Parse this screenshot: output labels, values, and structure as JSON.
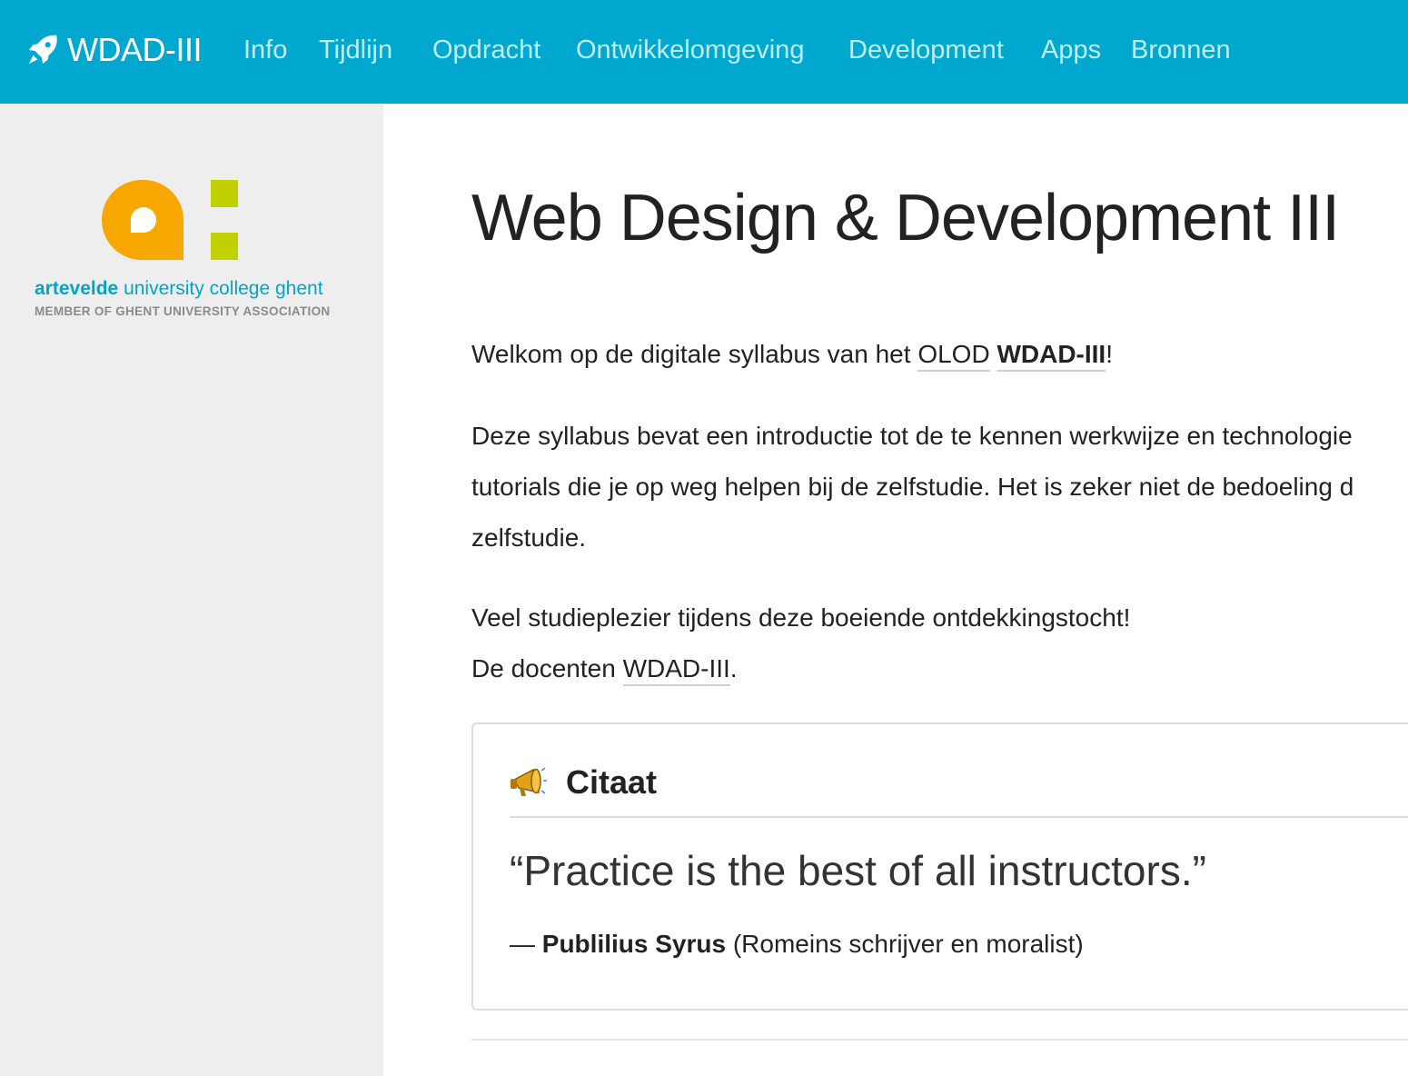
{
  "header": {
    "brand": "WDAD-III",
    "nav": [
      {
        "label": "Info"
      },
      {
        "label": "Tijdlijn"
      },
      {
        "label": "Opdracht"
      },
      {
        "label": "Ontwikkelomgeving"
      },
      {
        "label": "Development"
      },
      {
        "label": "Apps"
      },
      {
        "label": "Bronnen"
      }
    ],
    "colors": {
      "bar": "#00a8d0",
      "nav_text": "#bdeef8"
    }
  },
  "sidebar": {
    "logo": {
      "name_bold": "artevelde",
      "name_rest": " university college ghent",
      "member": "MEMBER OF GHENT UNIVERSITY ASSOCIATION",
      "colors": {
        "orange": "#f6a800",
        "green": "#c1d100",
        "text": "#00a5c8"
      }
    }
  },
  "main": {
    "title": "Web Design & Development III",
    "welcome": {
      "before": "Welkom op de digitale syllabus van het ",
      "olod": "OLOD",
      "space": " ",
      "course": "WDAD-III",
      "after": "!"
    },
    "intro_lines": [
      "Deze syllabus bevat een introductie tot de te kennen werkwijze en technologie",
      "tutorials die je op weg helpen bij de zelfstudie. Het is zeker niet de bedoeling d",
      "zelfstudie."
    ],
    "closing": "Veel studieplezier tijdens deze boeiende ontdekkingstocht!",
    "signature": {
      "before": "De docenten ",
      "course": "WDAD-III",
      "after": "."
    },
    "quote_card": {
      "icon": "megaphone-icon",
      "title": "Citaat",
      "quote": "“Practice is the best of all instructors.”",
      "dash": "— ",
      "author": "Publilius Syrus",
      "author_note": " (Romeins schrijver en moralist)"
    }
  }
}
